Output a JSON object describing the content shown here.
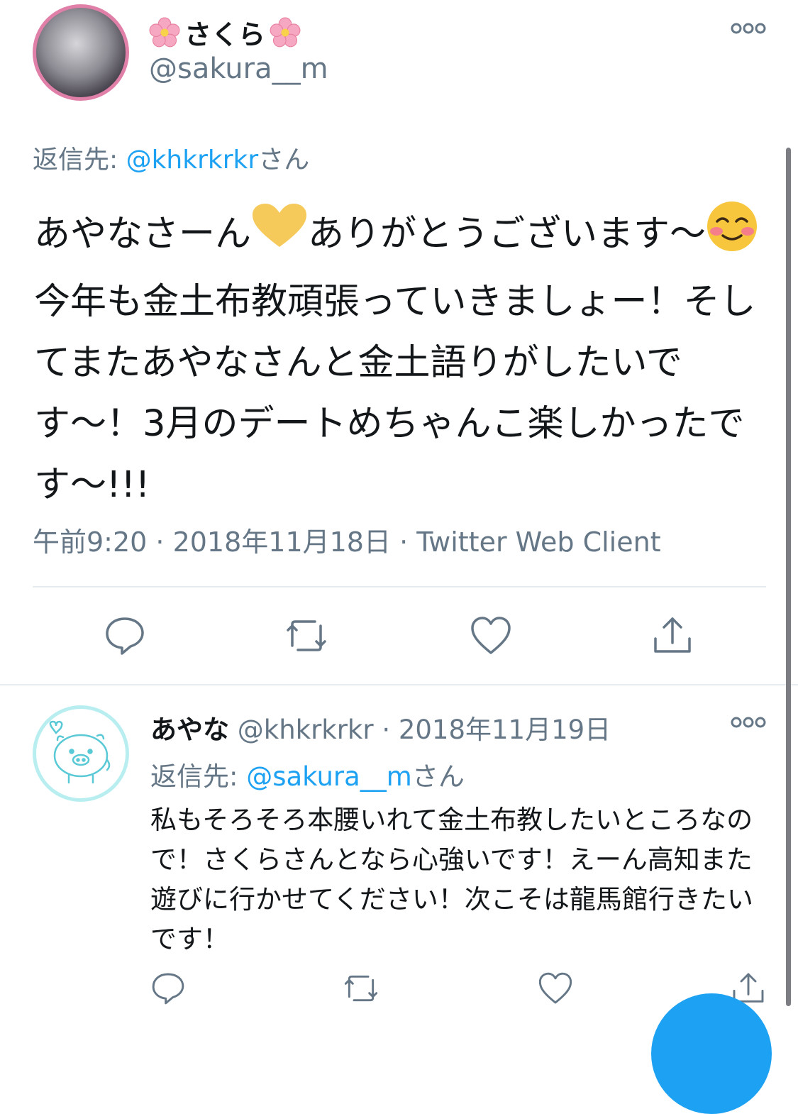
{
  "tweet": {
    "display_name": "さくら",
    "handle": "@sakura__m",
    "reply_to_prefix": "返信先: ",
    "reply_to_handle": "@khkrkrkr",
    "reply_to_suffix": "さん",
    "text_parts": [
      "あやなさーん",
      "ありがとうございます〜",
      "今年も金土布教頑張っていきましょー！そしてまたあやなさんと金土語りがしたいです〜！3月のデートめちゃんこ楽しかったです〜!!!"
    ],
    "emojis": [
      "yellow-heart",
      "smiling-face-with-blush"
    ],
    "timestamp": "午前9:20 · 2018年11月18日 · Twitter Web Client"
  },
  "reply": {
    "display_name": "あやな",
    "handle": "@khkrkrkr",
    "date": "· 2018年11月19日",
    "reply_to_prefix": "返信先: ",
    "reply_to_handle": "@sakura__m",
    "reply_to_suffix": "さん",
    "text": "私もそろそろ本腰いれて金土布教したいところなので！さくらさんとなら心強いです！えーん高知また遊びに行かせてください！次こそは龍馬館行きたいです！"
  },
  "actions": [
    "reply-icon",
    "retweet-icon",
    "like-icon",
    "share-icon"
  ],
  "colors": {
    "text": "#14171a",
    "muted": "#657786",
    "link": "#1da1f2",
    "divider": "#e6ecf0",
    "avatar_border_1": "#e07fa8",
    "avatar_border_2": "#b9eef1"
  }
}
